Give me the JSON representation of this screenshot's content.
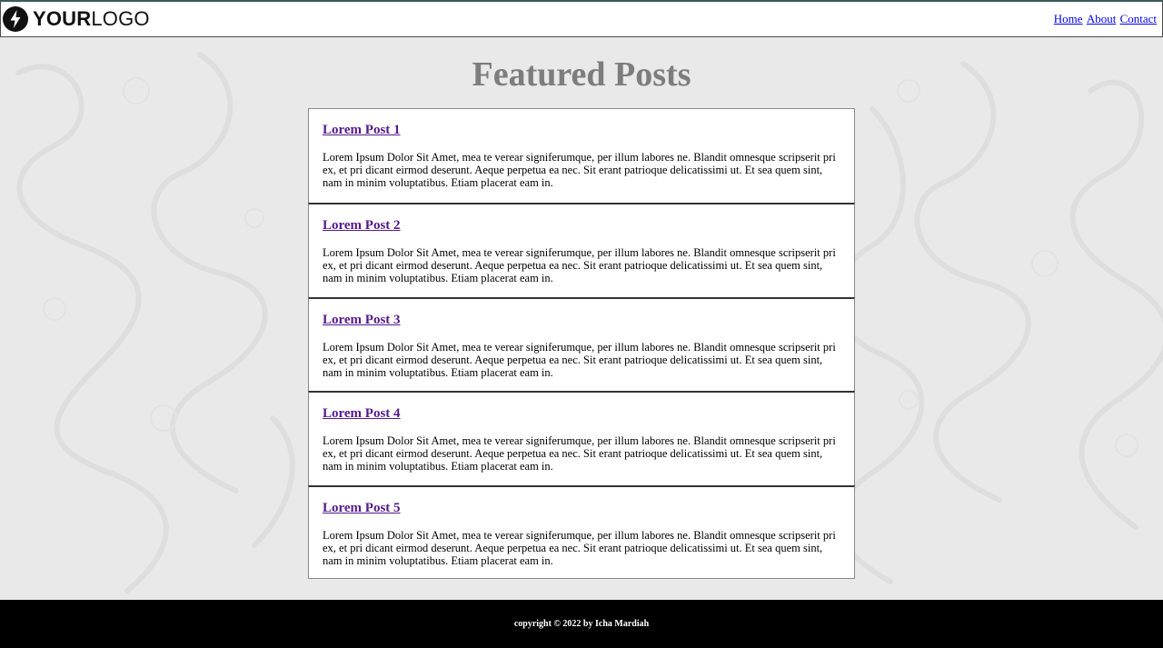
{
  "header": {
    "logo": {
      "icon": "lightning-bolt-icon",
      "text_bold": "YOUR",
      "text_regular": "LOGO"
    },
    "nav": [
      {
        "label": "Home"
      },
      {
        "label": "About"
      },
      {
        "label": "Contact"
      }
    ]
  },
  "main": {
    "title": "Featured Posts",
    "posts": [
      {
        "title": "Lorem Post 1",
        "body": "Lorem Ipsum Dolor Sit Amet, mea te verear signiferumque, per illum labores ne. Blandit omnesque scripserit pri ex, et pri dicant eirmod deserunt. Aeque perpetua ea nec. Sit erant patrioque delicatissimi ut. Et sea quem sint, nam in minim voluptatibus. Etiam placerat eam in."
      },
      {
        "title": "Lorem Post 2",
        "body": "Lorem Ipsum Dolor Sit Amet, mea te verear signiferumque, per illum labores ne. Blandit omnesque scripserit pri ex, et pri dicant eirmod deserunt. Aeque perpetua ea nec. Sit erant patrioque delicatissimi ut. Et sea quem sint, nam in minim voluptatibus. Etiam placerat eam in."
      },
      {
        "title": "Lorem Post 3",
        "body": "Lorem Ipsum Dolor Sit Amet, mea te verear signiferumque, per illum labores ne. Blandit omnesque scripserit pri ex, et pri dicant eirmod deserunt. Aeque perpetua ea nec. Sit erant patrioque delicatissimi ut. Et sea quem sint, nam in minim voluptatibus. Etiam placerat eam in."
      },
      {
        "title": "Lorem Post 4",
        "body": "Lorem Ipsum Dolor Sit Amet, mea te verear signiferumque, per illum labores ne. Blandit omnesque scripserit pri ex, et pri dicant eirmod deserunt. Aeque perpetua ea nec. Sit erant patrioque delicatissimi ut. Et sea quem sint, nam in minim voluptatibus. Etiam placerat eam in."
      },
      {
        "title": "Lorem Post 5",
        "body": "Lorem Ipsum Dolor Sit Amet, mea te verear signiferumque, per illum labores ne. Blandit omnesque scripserit pri ex, et pri dicant eirmod deserunt. Aeque perpetua ea nec. Sit erant patrioque delicatissimi ut. Et sea quem sint, nam in minim voluptatibus. Etiam placerat eam in."
      }
    ]
  },
  "footer": {
    "copyright": "copyright © 2022 by Icha Mardiah"
  },
  "colors": {
    "background": "#e9e9e9",
    "title": "#7d7d7d",
    "link_visited": "#551a8b",
    "link": "#0000ee",
    "footer_bg": "#000000"
  }
}
